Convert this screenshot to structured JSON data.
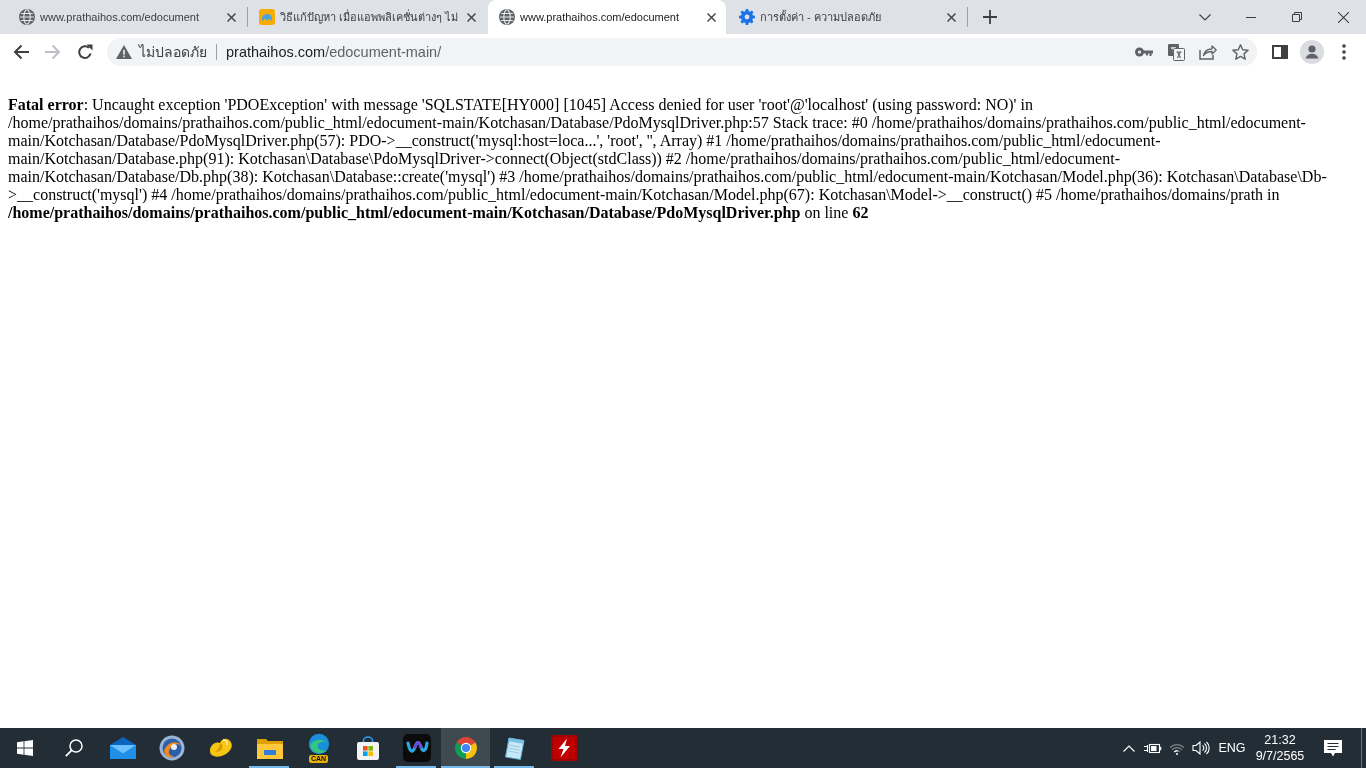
{
  "browser": {
    "tabs": [
      {
        "kind": "page",
        "title": "www.prathaihos.com/edocument",
        "selected": false
      },
      {
        "kind": "article",
        "title": "วิธีแก้ปัญหา เมื่อแอพพลิเคชั่นต่างๆ ไม่",
        "selected": false
      },
      {
        "kind": "page",
        "title": "www.prathaihos.com/edocument",
        "selected": true
      },
      {
        "kind": "settings",
        "title": "การตั้งค่า - ความปลอดภัย",
        "selected": false
      }
    ],
    "nav_buttons": [
      {
        "kind": "back",
        "disabled": false
      },
      {
        "kind": "forward",
        "disabled": true
      },
      {
        "kind": "reload",
        "disabled": false
      }
    ],
    "address_bar": {
      "security_label": "ไม่ปลอดภัย",
      "host": "prathaihos.com",
      "path": "/edocument-main/"
    }
  },
  "page": {
    "error_message": "**Fatal error**: Uncaught exception 'PDOException' with message 'SQLSTATE[HY000] [1045] Access denied for user 'root'@'localhost' (using password: NO)' in /home/prathaihos/domains/prathaihos.com/public_html/edocument-main/Kotchasan/Database/PdoMysqlDriver.php:57 Stack trace: #0 /home/prathaihos/domains/prathaihos.com/public_html/edocument-main/Kotchasan/Database/PdoMysqlDriver.php(57): PDO->__construct('mysql:host=loca...', 'root', '', Array) #1 /home/prathaihos/domains/prathaihos.com/public_html/edocument-main/Kotchasan/Database.php(91): Kotchasan\\Database\\PdoMysqlDriver->connect(Object(stdClass)) #2 /home/prathaihos/domains/prathaihos.com/public_html/edocument-main/Kotchasan/Database/Db.php(38): Kotchasan\\Database::create('mysql') #3 /home/prathaihos/domains/prathaihos.com/public_html/edocument-main/Kotchasan/Model.php(36): Kotchasan\\Database\\Db->__construct('mysql') #4 /home/prathaihos/domains/prathaihos.com/public_html/edocument-main/Kotchasan/Model.php(67): Kotchasan\\Model->__construct() #5 /home/prathaihos/domains/prath in **/home/prathaihos/domains/prathaihos.com/public_html/edocument-main/Kotchasan/Database/PdoMysqlDriver.php** on line **62**"
  },
  "taskbar": {
    "apps": [
      {
        "kind": "mail",
        "running": false,
        "selected": false
      },
      {
        "kind": "emblem",
        "running": false,
        "selected": false
      },
      {
        "kind": "petal",
        "running": false,
        "selected": false
      },
      {
        "kind": "files",
        "running": true,
        "selected": false
      },
      {
        "kind": "canary",
        "badge": "CAN",
        "running": false,
        "selected": false
      },
      {
        "kind": "store",
        "running": false,
        "selected": false
      },
      {
        "kind": "wave",
        "running": true,
        "selected": false
      },
      {
        "kind": "browser",
        "running": true,
        "selected": true
      },
      {
        "kind": "notepad",
        "running": true,
        "selected": false
      },
      {
        "kind": "ftp",
        "running": false,
        "selected": false
      }
    ],
    "tray": {
      "language": "ENG",
      "time": "21:32",
      "date": "9/7/2565"
    }
  }
}
